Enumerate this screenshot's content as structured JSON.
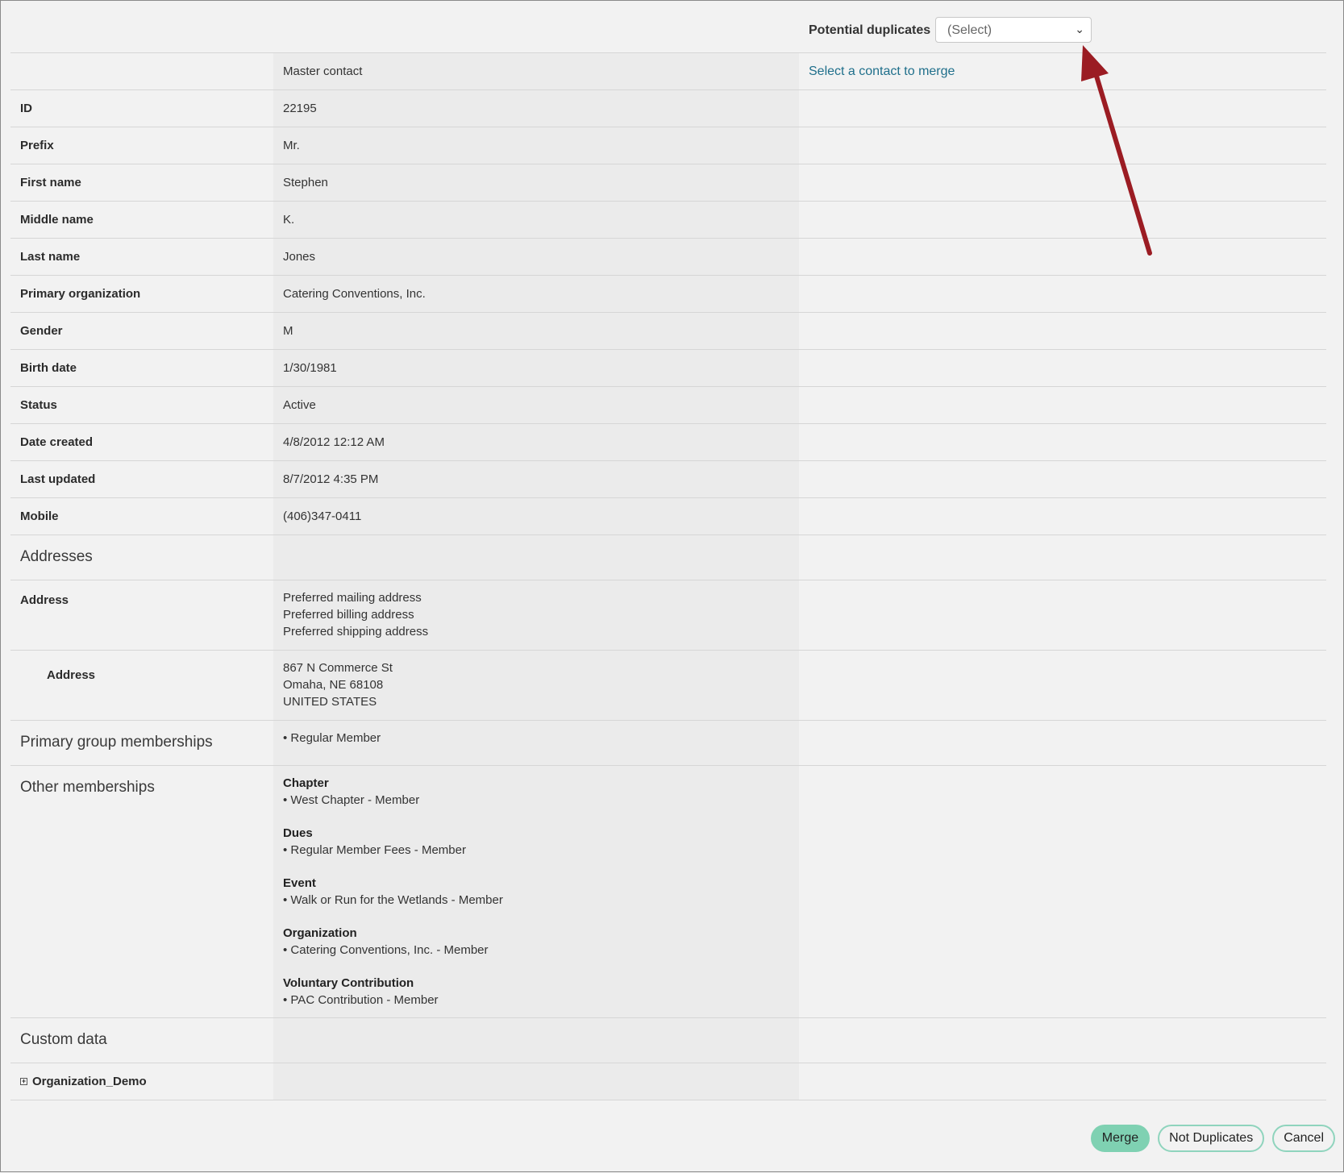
{
  "header": {
    "potential_duplicates_label": "Potential duplicates",
    "select_value": "(Select)",
    "chevron": "chevron-down-icon"
  },
  "columns": {
    "master_label": "Master contact",
    "merge_link": "Select a contact to merge"
  },
  "fields": [
    {
      "label": "ID",
      "value": "22195"
    },
    {
      "label": "Prefix",
      "value": "Mr."
    },
    {
      "label": "First name",
      "value": "Stephen"
    },
    {
      "label": "Middle name",
      "value": "K."
    },
    {
      "label": "Last name",
      "value": "Jones"
    },
    {
      "label": "Primary organization",
      "value": "Catering Conventions, Inc."
    },
    {
      "label": "Gender",
      "value": "M"
    },
    {
      "label": "Birth date",
      "value": "1/30/1981"
    },
    {
      "label": "Status",
      "value": "Active"
    },
    {
      "label": "Date created",
      "value": "4/8/2012 12:12 AM"
    },
    {
      "label": "Last updated",
      "value": "8/7/2012 4:35 PM"
    },
    {
      "label": "Mobile",
      "value": "(406)347-0411"
    }
  ],
  "addresses": {
    "title": "Addresses",
    "address_label": "Address",
    "preferences": [
      "Preferred mailing address",
      "Preferred billing address",
      "Preferred shipping address"
    ],
    "sub_label": "Address",
    "lines": [
      "867 N Commerce St",
      "Omaha, NE  68108",
      "UNITED STATES"
    ]
  },
  "primary_groups": {
    "title": "Primary group memberships",
    "items": [
      "• Regular Member"
    ]
  },
  "other_memberships": {
    "title": "Other memberships",
    "groups": [
      {
        "name": "Chapter",
        "item": "• West Chapter - Member"
      },
      {
        "name": "Dues",
        "item": "• Regular Member Fees - Member"
      },
      {
        "name": "Event",
        "item": "• Walk or Run for the Wetlands - Member"
      },
      {
        "name": "Organization",
        "item": "• Catering Conventions, Inc. - Member"
      },
      {
        "name": "Voluntary Contribution",
        "item": "• PAC Contribution - Member"
      }
    ]
  },
  "custom_data": {
    "title": "Custom data",
    "expand_icon": "plus-box-icon",
    "item": "Organization_Demo"
  },
  "buttons": {
    "merge": "Merge",
    "not_duplicates": "Not Duplicates",
    "cancel": "Cancel"
  },
  "colors": {
    "arrow": "#9b1c23",
    "link": "#1f6f8b",
    "button_accent": "#7fd1b2"
  }
}
